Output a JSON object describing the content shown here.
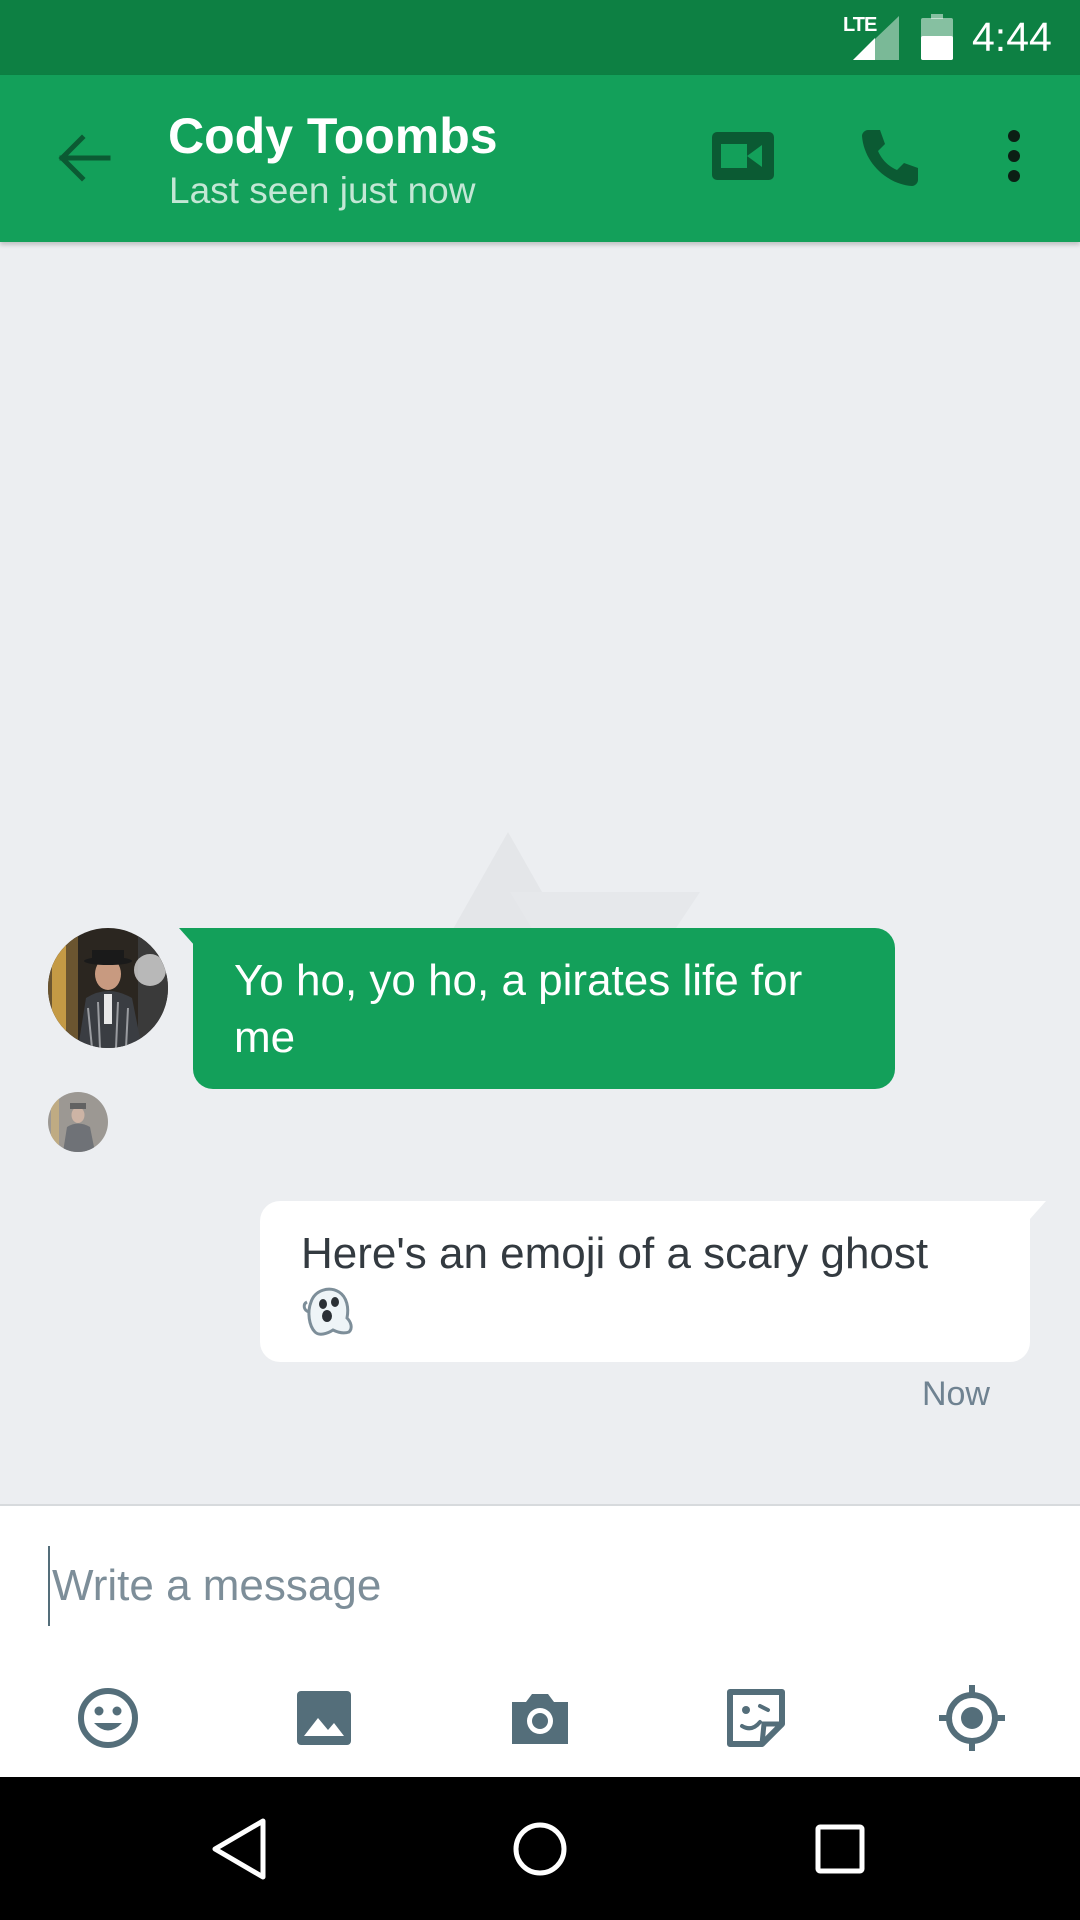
{
  "status_bar": {
    "network": "LTE",
    "time": "4:44"
  },
  "header": {
    "contact_name": "Cody Toombs",
    "contact_status": "Last seen just now",
    "icons": [
      "back-arrow-icon",
      "video-camera-icon",
      "phone-icon",
      "more-vert-icon"
    ]
  },
  "messages": [
    {
      "direction": "incoming",
      "text": "Yo ho, yo ho, a pirates life for me"
    },
    {
      "direction": "outgoing",
      "text": "Here's an emoji of a scary ghost",
      "emoji": "ghost-emoji",
      "time": "Now"
    }
  ],
  "composer": {
    "placeholder": "Write a message",
    "tools": [
      "emoji-icon",
      "image-icon",
      "camera-icon",
      "sticker-icon",
      "location-icon"
    ]
  },
  "nav": {
    "icons": [
      "back-triangle-icon",
      "home-circle-icon",
      "recents-square-icon"
    ]
  },
  "colors": {
    "status_bar": "#0d8043",
    "app_bar": "#13a05a",
    "chat_background": "#eceef1",
    "incoming_bubble": "#13a05a",
    "outgoing_bubble": "#ffffff",
    "icon_gray": "#546e7a"
  }
}
